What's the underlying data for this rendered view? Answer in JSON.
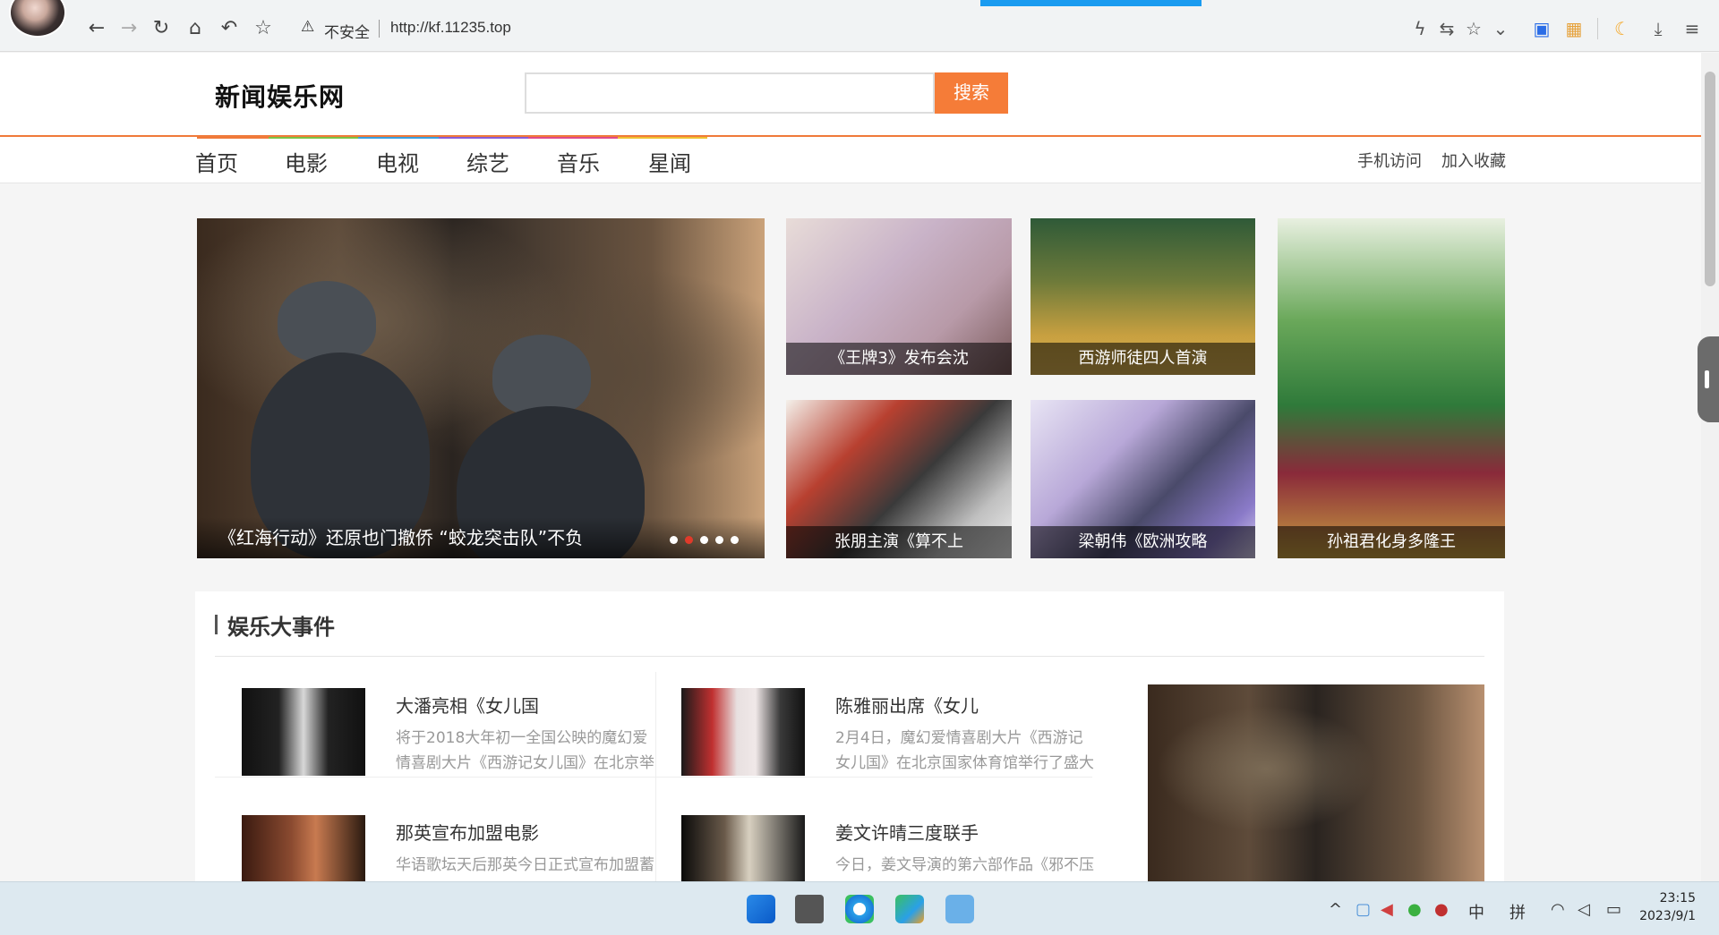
{
  "browser": {
    "security_label": "不安全",
    "url": "http://kf.11235.top"
  },
  "site": {
    "logo": "新闻娱乐网",
    "search_placeholder": "",
    "search_button": "搜索"
  },
  "nav": {
    "items": [
      "首页",
      "电影",
      "电视",
      "综艺",
      "音乐",
      "星闻"
    ],
    "mobile": "手机访问",
    "bookmark": "加入收藏"
  },
  "slider": {
    "caption": "《红海行动》还原也门撤侨 “蛟龙突击队”不负",
    "dots": 5,
    "active_dot": 1
  },
  "tiles": [
    {
      "caption": "《王牌3》发布会沈"
    },
    {
      "caption": "西游师徒四人首演"
    },
    {
      "caption": "张朋主演《算不上"
    },
    {
      "caption": "梁朝伟《欧洲攻略"
    },
    {
      "caption": "孙祖君化身多隆王"
    }
  ],
  "events": {
    "title": "娱乐大事件",
    "news": [
      {
        "title": "大潘亮相《女儿国",
        "summary": "将于2018大年初一全国公映的魔幻爱情喜剧大片《西游记女儿国》在北京举"
      },
      {
        "title": "陈雅丽出席《女儿",
        "summary": "2月4日，魔幻爱情喜剧大片《西游记女儿国》在北京国家体育馆举行了盛大"
      },
      {
        "title": "那英宣布加盟电影",
        "summary": "华语歌坛天后那英今日正式宣布加盟蓄"
      },
      {
        "title": "姜文许晴三度联手",
        "summary": "今日，姜文导演的第六部作品《邪不压"
      }
    ]
  },
  "taskbar": {
    "ime_lang": "中",
    "ime_mode": "拼",
    "time": "23:15",
    "date": "2023/9/1"
  },
  "colors": {
    "accent_orange": "#f57c38",
    "loading_bar": "#1a9bf0"
  }
}
